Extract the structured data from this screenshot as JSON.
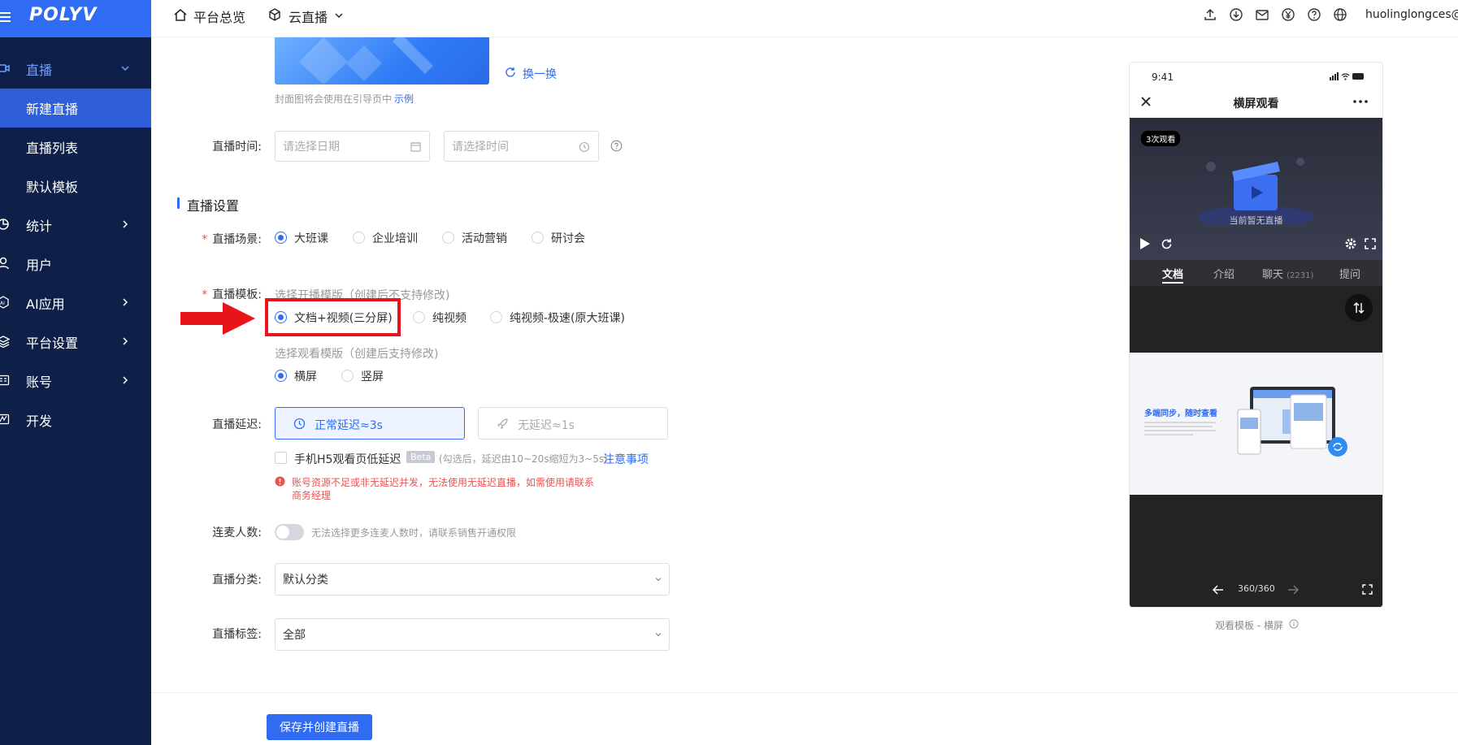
{
  "brand": {
    "logo": "POLYV",
    "accent": "#2f6bf3",
    "sidebar_bg": "#0f2048"
  },
  "sidebar": {
    "items": [
      {
        "label": "直播",
        "icon": "video-icon",
        "expanded": true
      },
      {
        "label": "新建直播",
        "active": true
      },
      {
        "label": "直播列表"
      },
      {
        "label": "默认模板"
      },
      {
        "label": "统计",
        "icon": "chart-icon"
      },
      {
        "label": "用户",
        "icon": "user-icon"
      },
      {
        "label": "AI应用",
        "icon": "ai-icon"
      },
      {
        "label": "平台设置",
        "icon": "layers-icon"
      },
      {
        "label": "账号",
        "icon": "account-icon"
      },
      {
        "label": "开发",
        "icon": "dev-icon"
      }
    ]
  },
  "topbar": {
    "overview": "平台总览",
    "product": "云直播",
    "user": "huolinglongces@p",
    "icons": [
      "upload-icon",
      "download-icon",
      "mail-icon",
      "yen-icon",
      "help-icon",
      "globe-icon"
    ]
  },
  "cover": {
    "refresh": "换一换",
    "note": "封面图将会使用在引导页中",
    "example": "示例"
  },
  "time": {
    "label": "直播时间:",
    "date_placeholder": "请选择日期",
    "time_placeholder": "请选择时间"
  },
  "section": {
    "title": "直播设置"
  },
  "scene": {
    "label": "直播场景:",
    "options": [
      "大班课",
      "企业培训",
      "活动营销",
      "研讨会"
    ],
    "selected": "大班课"
  },
  "template": {
    "label": "直播模板:",
    "broadcast_hint": "选择开播模版（创建后不支持修改)",
    "options": [
      "文档+视频(三分屏)",
      "纯视频",
      "纯视频-极速(原大班课)"
    ],
    "selected": "文档+视频(三分屏)",
    "view_hint": "选择观看模版（创建后支持修改)",
    "view_options": [
      "横屏",
      "竖屏"
    ],
    "view_selected": "横屏"
  },
  "delay": {
    "label": "直播延迟:",
    "normal": "正常延迟≈3s",
    "none": "无延迟≈1s",
    "h5_label": "手机H5观看页低延迟",
    "beta": "Beta",
    "h5_hint": "(勾选后，延迟由10~20s缩短为3~5s)",
    "notice": "注意事项",
    "warning_line1": "账号资源不足或非无延迟并发，无法使用无延迟直播，如需使用请联系",
    "warning_line2": "商务经理"
  },
  "mic": {
    "label": "连麦人数:",
    "hint": "无法选择更多连麦人数时，请联系销售开通权限",
    "enabled": false
  },
  "category": {
    "label": "直播分类:",
    "value": "默认分类"
  },
  "tags": {
    "label": "直播标签:",
    "value": "全部"
  },
  "submit": "保存并创建直播",
  "preview": {
    "time": "9:41",
    "title": "横屏观看",
    "views_badge": "3次观看",
    "no_live": "当前暂无直播",
    "tabs": [
      "文档",
      "介绍",
      "聊天",
      "提问"
    ],
    "chat_count": "(2231)",
    "doc_title": "多端同步，随时查看",
    "page": "360/360",
    "caption": "观看模板 - 横屏"
  }
}
